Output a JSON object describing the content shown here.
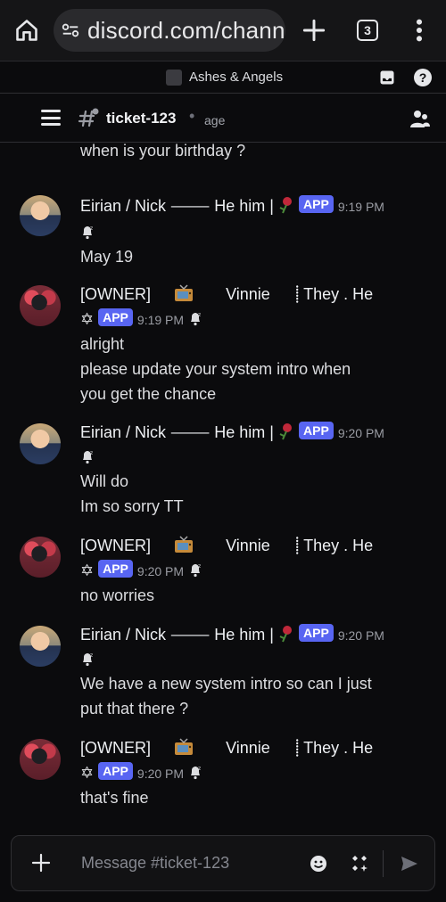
{
  "browser": {
    "url": "discord.com/chann",
    "tab_count": "3"
  },
  "server": {
    "name": "Ashes & Angels"
  },
  "channel": {
    "name": "ticket-123",
    "separator": "•",
    "topic": "age"
  },
  "messages": {
    "partial": {
      "text": "when is your birthday ?"
    },
    "m1": {
      "name": "Eirian / Nick ⸻  He him |",
      "badge": "APP",
      "time": "9:19 PM",
      "lines": [
        "May 19"
      ]
    },
    "m2": {
      "name_a": "[OWNER]",
      "name_b": "Vinnie",
      "name_c": "⸽ They . He",
      "prefix": "✡",
      "badge": "APP",
      "time": "9:19 PM",
      "lines": [
        "alright",
        "please update your system intro when",
        "you get the chance"
      ]
    },
    "m3": {
      "name": "Eirian / Nick ⸻  He him |",
      "badge": "APP",
      "time": "9:20 PM",
      "lines": [
        "Will do",
        "Im so sorry TT"
      ]
    },
    "m4": {
      "name_a": "[OWNER]",
      "name_b": "Vinnie",
      "name_c": "⸽ They . He",
      "prefix": "✡",
      "badge": "APP",
      "time": "9:20 PM",
      "lines": [
        "no worries"
      ]
    },
    "m5": {
      "name": "Eirian / Nick ⸻  He him |",
      "badge": "APP",
      "time": "9:20 PM",
      "lines": [
        "We have a new system intro so can I just",
        "put that there ?"
      ]
    },
    "m6": {
      "name_a": "[OWNER]",
      "name_b": "Vinnie",
      "name_c": "⸽ They . He",
      "prefix": "✡",
      "badge": "APP",
      "time": "9:20 PM",
      "lines": [
        "that's fine"
      ]
    }
  },
  "composer": {
    "placeholder": "Message #ticket-123"
  },
  "colors": {
    "app_badge": "#5865f2",
    "background": "#0b0b0d",
    "timestamp": "#9a9ca3"
  }
}
